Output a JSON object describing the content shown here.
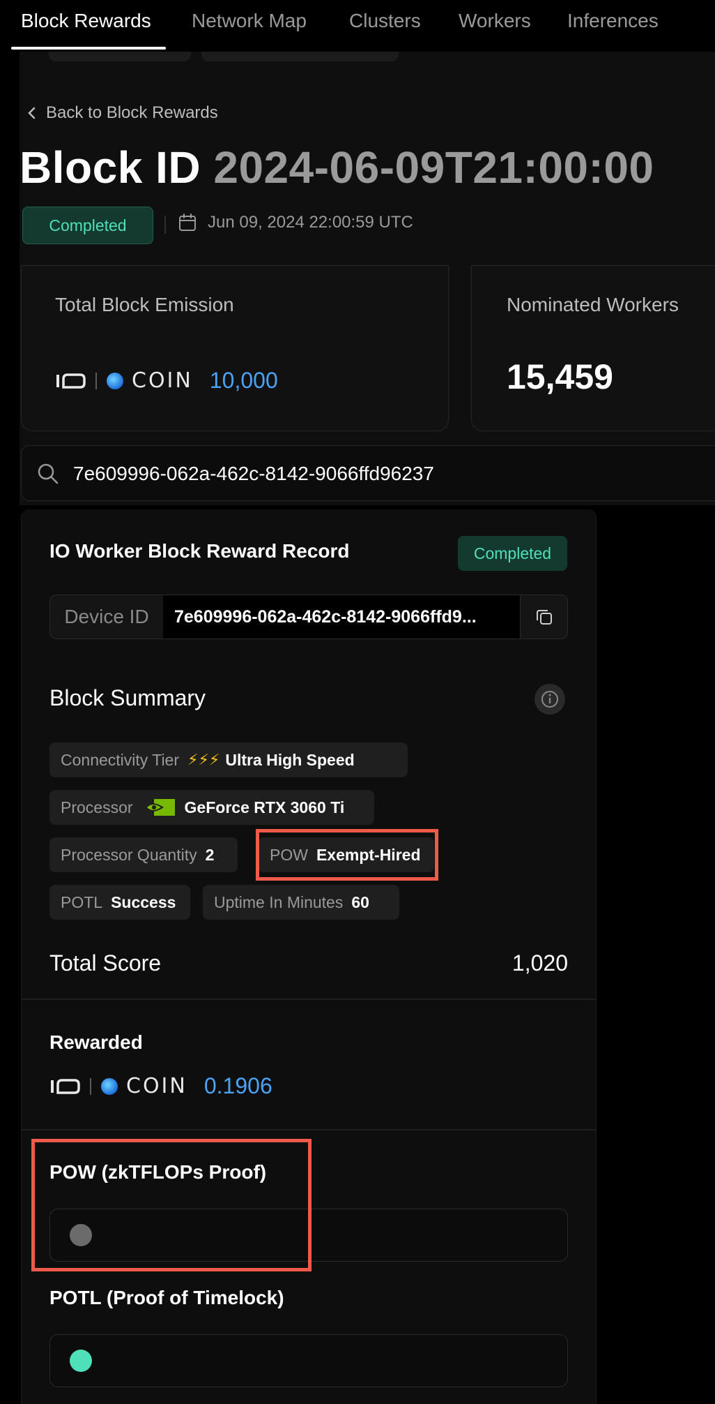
{
  "nav": {
    "tabs": [
      {
        "label": "Block Rewards",
        "active": true
      },
      {
        "label": "Network Map",
        "active": false
      },
      {
        "label": "Clusters",
        "active": false
      },
      {
        "label": "Workers",
        "active": false
      },
      {
        "label": "Inferences",
        "active": false
      }
    ]
  },
  "header": {
    "back_label": "Back to Block Rewards",
    "title_prefix": "Block ID",
    "block_id": "2024-06-09T21:00:00",
    "status": "Completed",
    "timestamp": "Jun 09, 2024 22:00:59 UTC"
  },
  "stats": {
    "emission_label": "Total Block Emission",
    "emission_value": "10,000",
    "workers_label": "Nominated Workers",
    "workers_value": "15,459"
  },
  "coin": {
    "brand": "io",
    "word": "COIN"
  },
  "search": {
    "value": "7e609996-062a-462c-8142-9066ffd96237"
  },
  "record": {
    "title": "IO Worker Block Reward Record",
    "status": "Completed",
    "device_label": "Device ID",
    "device_value": "7e609996-062a-462c-8142-9066ffd9...",
    "summary_title": "Block Summary",
    "chips": {
      "connectivity_key": "Connectivity Tier",
      "connectivity_val": "Ultra High Speed",
      "processor_key": "Processor",
      "processor_val": "GeForce RTX 3060 Ti",
      "quantity_key": "Processor Quantity",
      "quantity_val": "2",
      "pow_key": "POW",
      "pow_val": "Exempt-Hired",
      "potl_key": "POTL",
      "potl_val": "Success",
      "uptime_key": "Uptime In Minutes",
      "uptime_val": "60"
    },
    "score_label": "Total Score",
    "score_value": "1,020",
    "rewarded_label": "Rewarded",
    "rewarded_value": "0.1906",
    "pow_proof_title": "POW (zkTFLOPs Proof)",
    "potl_proof_title": "POTL (Proof of Timelock)"
  },
  "colors": {
    "accent_blue": "#4aa3f7",
    "success_green": "#4fe0b9",
    "highlight_red": "#f05a4a",
    "pow_dot": "#6b6b6b",
    "potl_dot": "#4fe0b9"
  }
}
